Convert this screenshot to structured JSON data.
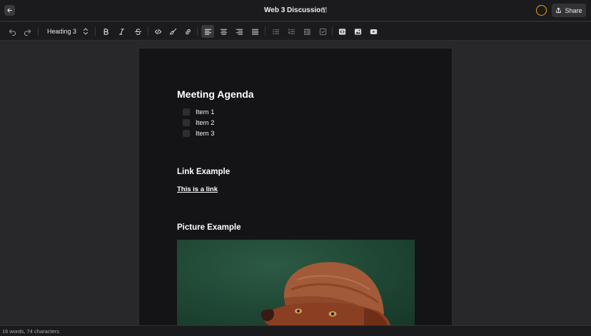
{
  "header": {
    "title": "Web 3 Discussion",
    "share_label": "Share"
  },
  "toolbar": {
    "block_type": "Heading 3"
  },
  "document": {
    "heading": "Meeting Agenda",
    "tasks": [
      {
        "label": "Item 1",
        "checked": false
      },
      {
        "label": "Item 2",
        "checked": false
      },
      {
        "label": "Item 3",
        "checked": false
      }
    ],
    "link_heading": "Link Example",
    "link_text": "This is a link",
    "picture_heading": "Picture Example"
  },
  "status": {
    "counts": "16 words, 74 characters"
  },
  "colors": {
    "avatar_ring": "#e7a712",
    "photo_background": "#1f4634",
    "hat": "#a35a38",
    "dog": "#8b3f22"
  }
}
